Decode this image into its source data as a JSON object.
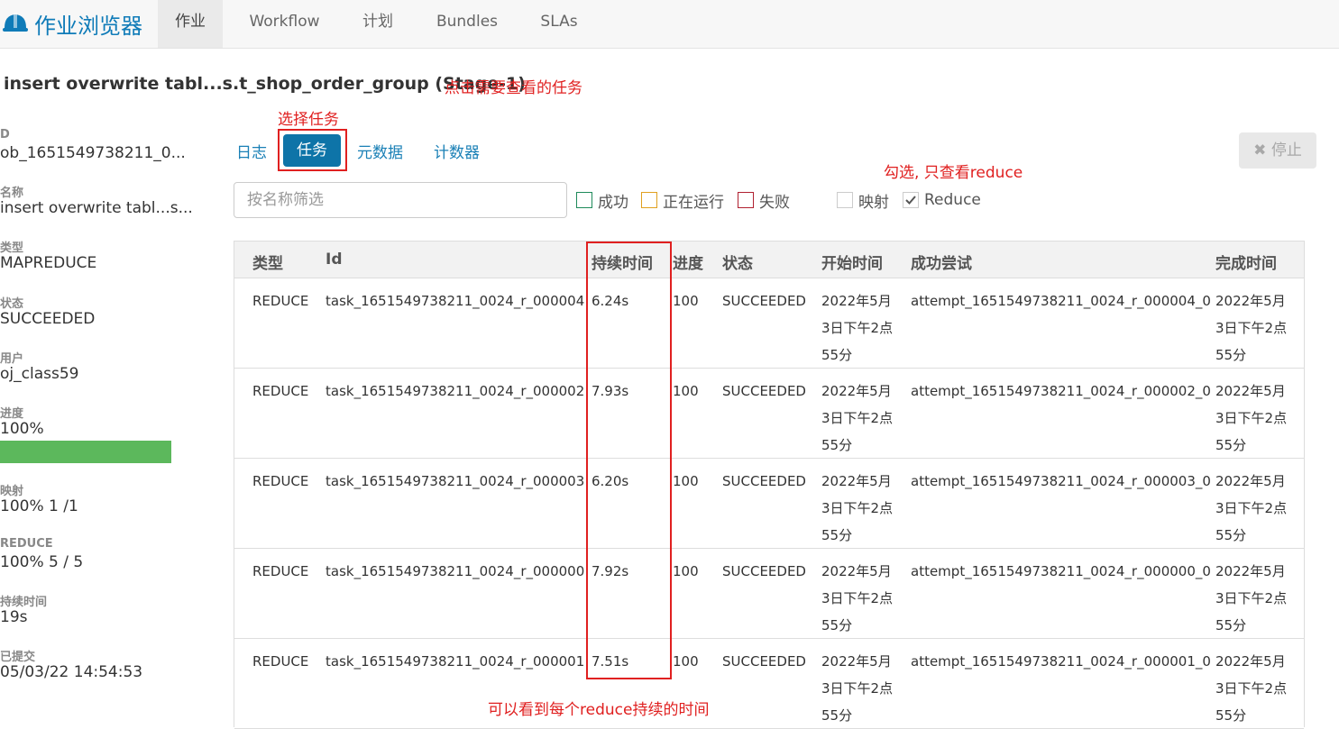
{
  "app": {
    "title": "作业浏览器",
    "nav": [
      "作业",
      "Workflow",
      "计划",
      "Bundles",
      "SLAs"
    ]
  },
  "page": {
    "title": "insert overwrite tabl...s.t_shop_order_group (Stage-1)"
  },
  "annotations": {
    "title_note": "点击需要查看的任务",
    "tab_note": "选择任务",
    "filter_note": "勾选, 只查看reduce",
    "duration_note": "可以看到每个reduce持续的时间"
  },
  "info": [
    {
      "label": "D",
      "value": "ob_1651549738211_0..."
    },
    {
      "label": "名称",
      "value": "insert overwrite tabl...s..."
    },
    {
      "label": "类型",
      "value": "MAPREDUCE"
    },
    {
      "label": "状态",
      "value": "SUCCEEDED"
    },
    {
      "label": "用户",
      "value": "oj_class59"
    },
    {
      "label": "进度",
      "value": "100%"
    },
    {
      "label": "映射",
      "value": "100% 1 /1"
    },
    {
      "label": "REDUCE",
      "value": "100% 5 / 5"
    },
    {
      "label": "持续时间",
      "value": "19s"
    },
    {
      "label": "已提交",
      "value": "05/03/22 14:54:53"
    }
  ],
  "progress": 1.0,
  "tabs": [
    "日志",
    "任务",
    "元数据",
    "计数器"
  ],
  "stop_button": "停止",
  "filter": {
    "placeholder": "按名称筛选"
  },
  "status_filters": [
    {
      "label": "成功",
      "color": "#1e8a5a",
      "checked": false
    },
    {
      "label": "正在运行",
      "color": "#e0a020",
      "checked": false
    },
    {
      "label": "失败",
      "color": "#b02030",
      "checked": false
    }
  ],
  "type_filters": [
    {
      "label": "映射",
      "checked": false
    },
    {
      "label": "Reduce",
      "checked": true
    }
  ],
  "table": {
    "headers": [
      "类型",
      "Id",
      "持续时间",
      "进度",
      "状态",
      "开始时间",
      "成功尝试",
      "完成时间"
    ],
    "rows": [
      [
        "REDUCE",
        "task_1651549738211_0024_r_000004",
        "6.24s",
        "100",
        "SUCCEEDED",
        "2022年5月3日下午2点55分",
        "attempt_1651549738211_0024_r_000004_0",
        "2022年5月3日下午2点55分"
      ],
      [
        "REDUCE",
        "task_1651549738211_0024_r_000002",
        "7.93s",
        "100",
        "SUCCEEDED",
        "2022年5月3日下午2点55分",
        "attempt_1651549738211_0024_r_000002_0",
        "2022年5月3日下午2点55分"
      ],
      [
        "REDUCE",
        "task_1651549738211_0024_r_000003",
        "6.20s",
        "100",
        "SUCCEEDED",
        "2022年5月3日下午2点55分",
        "attempt_1651549738211_0024_r_000003_0",
        "2022年5月3日下午2点55分"
      ],
      [
        "REDUCE",
        "task_1651549738211_0024_r_000000",
        "7.92s",
        "100",
        "SUCCEEDED",
        "2022年5月3日下午2点55分",
        "attempt_1651549738211_0024_r_000000_0",
        "2022年5月3日下午2点55分"
      ],
      [
        "REDUCE",
        "task_1651549738211_0024_r_000001",
        "7.51s",
        "100",
        "SUCCEEDED",
        "2022年5月3日下午2点55分",
        "attempt_1651549738211_0024_r_000001_0",
        "2022年5月3日下午2点55分"
      ]
    ]
  }
}
